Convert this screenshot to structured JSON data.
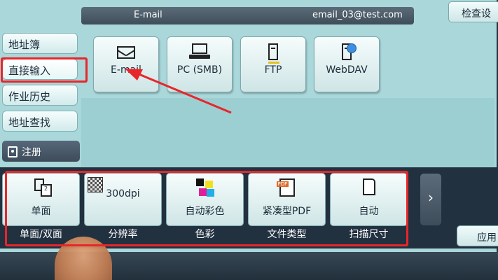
{
  "header": {
    "label": "E-mail",
    "address": "email_03@test.com",
    "check_button": "检查设"
  },
  "sidebar": {
    "items": [
      {
        "label": "地址簿",
        "selected": false
      },
      {
        "label": "直接输入",
        "selected": true
      },
      {
        "label": "作业历史",
        "selected": false
      },
      {
        "label": "地址查找",
        "selected": false
      }
    ],
    "register": "注册"
  },
  "destinations": [
    {
      "label": "E-mail",
      "icon": "envelope-icon"
    },
    {
      "label": "PC (SMB)",
      "icon": "computer-icon"
    },
    {
      "label": "FTP",
      "icon": "server-icon"
    },
    {
      "label": "WebDAV",
      "icon": "webdav-server-icon"
    }
  ],
  "settings": [
    {
      "value": "单面",
      "caption": "单面/双面",
      "icon": "duplex-icon"
    },
    {
      "value": "300dpi",
      "caption": "分辨率",
      "icon": "resolution-icon"
    },
    {
      "value": "自动彩色",
      "caption": "色彩",
      "icon": "color-icon"
    },
    {
      "value": "紧凑型PDF",
      "caption": "文件类型",
      "icon": "pdf-icon"
    },
    {
      "value": "自动",
      "caption": "扫描尺寸",
      "icon": "page-size-icon"
    }
  ],
  "next_button": "›",
  "apply_button": "应用",
  "colors": {
    "screen_bg": "#a9d7da",
    "dark_bar": "#223140",
    "annotation_red": "#e8262a"
  }
}
